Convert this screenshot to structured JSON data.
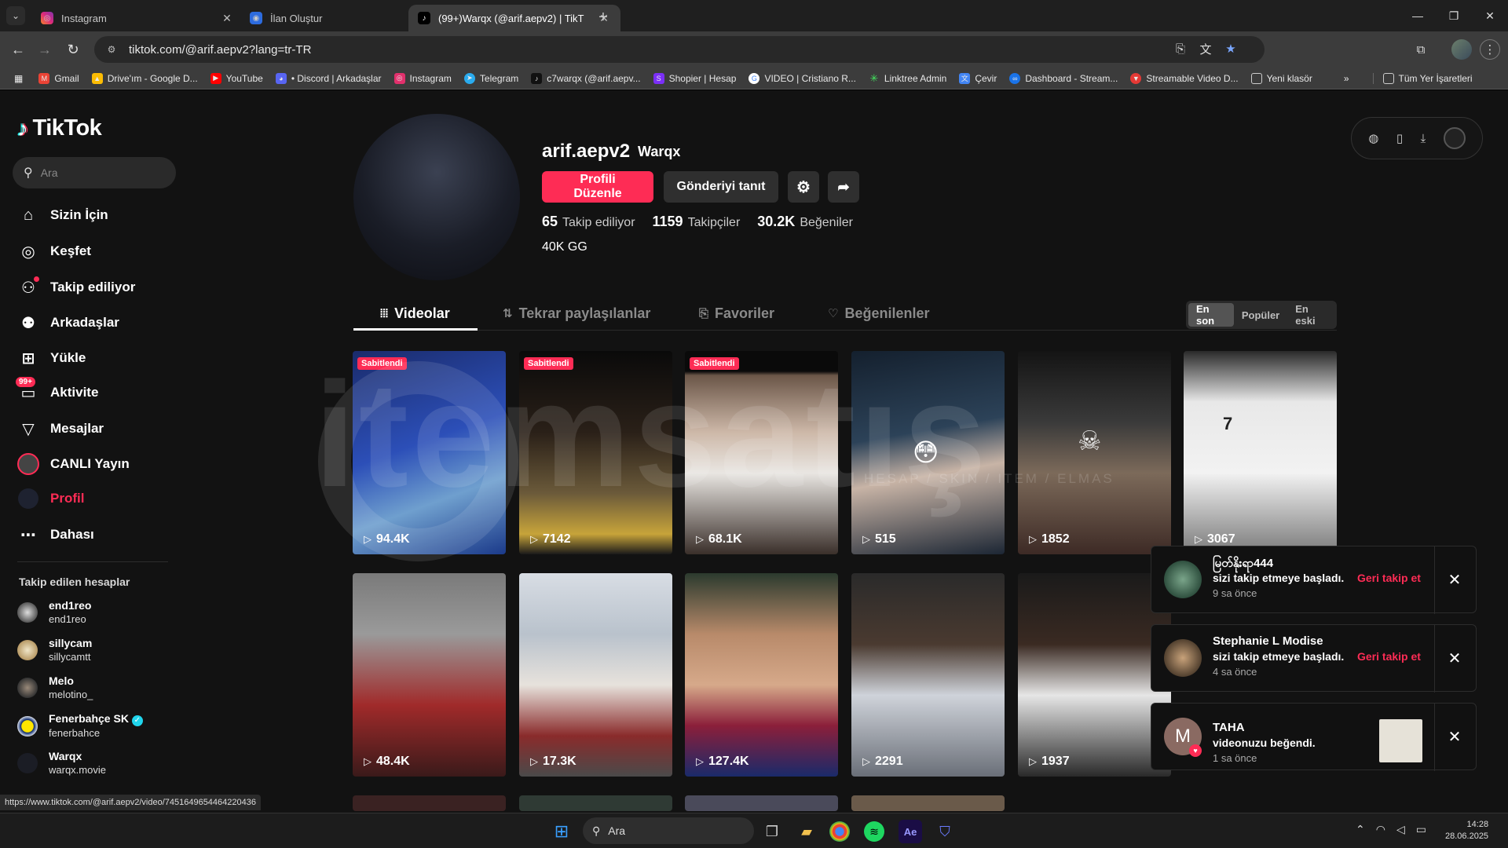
{
  "browser": {
    "tabs": [
      {
        "title": "Instagram",
        "icon": "instagram-icon"
      },
      {
        "title": "İlan Oluştur",
        "icon": "site-icon"
      },
      {
        "title": "(99+)Warqx (@arif.aepv2) | TikT",
        "icon": "tiktok-icon"
      }
    ],
    "url": "tiktok.com/@arif.aepv2?lang=tr-TR",
    "bookmarks": [
      {
        "label": "Gmail",
        "icon": "gmail-icon",
        "color": "#ea4335"
      },
      {
        "label": "Drive'ım - Google D...",
        "icon": "drive-icon",
        "color": "#fbbc04"
      },
      {
        "label": "YouTube",
        "icon": "youtube-icon",
        "color": "#ff0000"
      },
      {
        "label": "• Discord | Arkadaşlar",
        "icon": "discord-icon",
        "color": "#5865f2"
      },
      {
        "label": "Instagram",
        "icon": "instagram-icon",
        "color": "#e1306c"
      },
      {
        "label": "Telegram",
        "icon": "telegram-icon",
        "color": "#2aabee"
      },
      {
        "label": "c7warqx (@arif.aepv...",
        "icon": "tiktok-icon",
        "color": "#111111"
      },
      {
        "label": "Shopier | Hesap",
        "icon": "shopier-icon",
        "color": "#7b2ff7"
      },
      {
        "label": "VIDEO | Cristiano R...",
        "icon": "google-icon",
        "color": "#4285f4"
      },
      {
        "label": "Linktree Admin",
        "icon": "linktree-icon",
        "color": "#43e55e"
      },
      {
        "label": "Çevir",
        "icon": "translate-icon",
        "color": "#4285f4"
      },
      {
        "label": "Dashboard - Stream...",
        "icon": "dashboard-icon",
        "color": "#1a73e8"
      },
      {
        "label": "Streamable Video D...",
        "icon": "streamable-icon",
        "color": "#e53935"
      },
      {
        "label": "Yeni klasör",
        "icon": "folder-icon",
        "color": "#3c3c3c"
      }
    ],
    "more_bookmarks": "»",
    "all_bookmarks": "Tüm Yer İşaretleri"
  },
  "sidebar": {
    "brand": "TikTok",
    "search_placeholder": "Ara",
    "nav": [
      {
        "label": "Sizin İçin",
        "icon": "home-icon",
        "active": false
      },
      {
        "label": "Keşfet",
        "icon": "compass-icon",
        "active": false
      },
      {
        "label": "Takip ediliyor",
        "icon": "following-icon",
        "active": false
      },
      {
        "label": "Arkadaşlar",
        "icon": "friends-icon",
        "active": false
      },
      {
        "label": "Yükle",
        "icon": "upload-icon",
        "active": false
      },
      {
        "label": "Aktivite",
        "icon": "inbox-icon",
        "badge": "99+",
        "active": false
      },
      {
        "label": "Mesajlar",
        "icon": "send-icon",
        "active": false
      },
      {
        "label": "CANLI Yayın",
        "icon": "live-icon",
        "active": false
      },
      {
        "label": "Profil",
        "icon": "profile-avatar",
        "active": true
      },
      {
        "label": "Dahası",
        "icon": "more-icon",
        "active": false
      }
    ],
    "following_title": "Takip edilen hesaplar",
    "following": [
      {
        "name": "end1reo",
        "handle": "end1reo"
      },
      {
        "name": "sillycam",
        "handle": "sillycamtt"
      },
      {
        "name": "Melo",
        "handle": "melotino_"
      },
      {
        "name": "Fenerbahçe SK",
        "handle": "fenerbahce",
        "verified": true
      },
      {
        "name": "Warqx",
        "handle": "warqx.movie"
      }
    ]
  },
  "profile": {
    "username": "arif.aepv2",
    "display_name": "Warqx",
    "edit_label": "Profili Düzenle",
    "promote_label": "Gönderiyi tanıt",
    "stats": [
      {
        "value": "65",
        "label": "Takip ediliyor"
      },
      {
        "value": "1159",
        "label": "Takipçiler"
      },
      {
        "value": "30.2K",
        "label": "Beğeniler"
      }
    ],
    "bio": "40K GG"
  },
  "content_tabs": [
    {
      "label": "Videolar",
      "icon": "grid-icon"
    },
    {
      "label": "Tekrar paylaşılanlar",
      "icon": "repost-icon"
    },
    {
      "label": "Favoriler",
      "icon": "bookmark-icon"
    },
    {
      "label": "Beğenilenler",
      "icon": "heart-icon"
    }
  ],
  "sort_options": [
    "En son",
    "Popüler",
    "En eski"
  ],
  "pinned_label": "Sabitlendi",
  "videos": [
    {
      "views": "94.4K",
      "pinned": true
    },
    {
      "views": "7142",
      "pinned": true
    },
    {
      "views": "68.1K",
      "pinned": true
    },
    {
      "views": "515",
      "pinned": false
    },
    {
      "views": "1852",
      "pinned": false
    },
    {
      "views": "3067",
      "pinned": false
    },
    {
      "views": "48.4K",
      "pinned": false
    },
    {
      "views": "17.3K",
      "pinned": false
    },
    {
      "views": "127.4K",
      "pinned": false
    },
    {
      "views": "2291",
      "pinned": false
    },
    {
      "views": "1937",
      "pinned": false
    }
  ],
  "watermark": {
    "text": "itemsatış",
    "subtitle": "HESAP / SKIN / ITEM / ELMAS"
  },
  "notifications": [
    {
      "name": "မြတ်နိုးရာ444",
      "message": "sizi takip etmeye başladı.",
      "time": "9 sa önce",
      "action": "Geri takip et"
    },
    {
      "name": "Stephanie L Modise",
      "message": "sizi takip etmeye başladı.",
      "time": "4 sa önce",
      "action": "Geri takip et"
    },
    {
      "name": "TAHA",
      "message": "videonuzu beğendi.",
      "time": "1 sa önce",
      "initial": "M"
    }
  ],
  "status_url": "https://www.tiktok.com/@arif.aepv2/video/7451649654464220436",
  "taskbar": {
    "search_placeholder": "Ara",
    "time": "14:28",
    "date": "28.06.2025"
  },
  "colors": {
    "accent": "#fe2c55",
    "background": "#121212"
  }
}
